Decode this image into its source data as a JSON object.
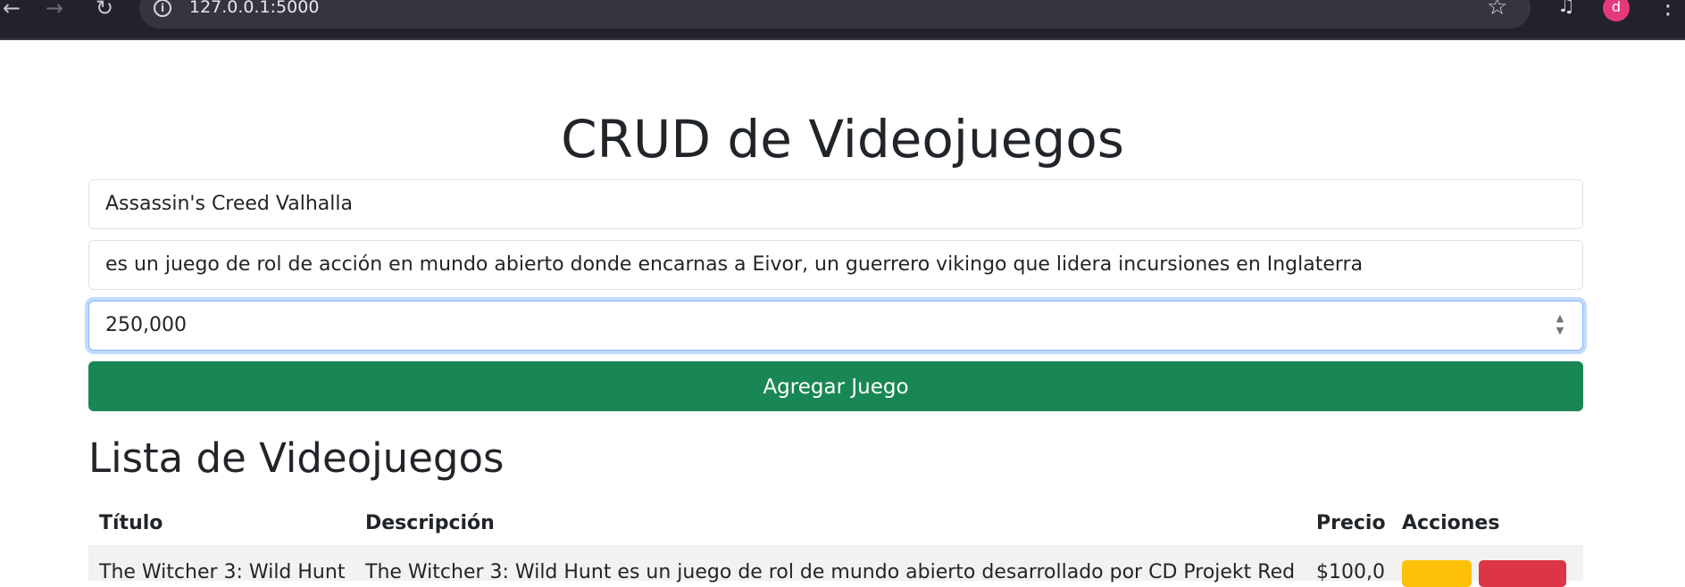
{
  "browser": {
    "url": "127.0.0.1:5000",
    "avatar_letter": "d",
    "colors": {
      "frame": "#23222b",
      "omnibox": "#36353f",
      "avatar": "#e6397b"
    }
  },
  "page": {
    "title": "CRUD de Videojuegos",
    "form": {
      "title_value": "Assassin's Creed Valhalla",
      "description_value": "es un juego de rol de acción en mundo abierto donde encarnas a Eivor, un guerrero vikingo que lidera incursiones en Inglaterra",
      "price_value": "250,000",
      "submit_label": "Agregar Juego"
    },
    "list_title": "Lista de Videojuegos",
    "table": {
      "headers": [
        "Título",
        "Descripción",
        "Precio",
        "Acciones"
      ],
      "rows": [
        {
          "title": "The Witcher 3: Wild Hunt",
          "description": "The Witcher 3: Wild Hunt es un juego de rol de mundo abierto desarrollado por CD Projekt Red",
          "price": "$100,0"
        }
      ]
    },
    "colors": {
      "primary_button": "#198754",
      "edit_button": "#ffc107",
      "delete_button": "#dc3545",
      "focus_ring": "#86b7fe"
    }
  }
}
